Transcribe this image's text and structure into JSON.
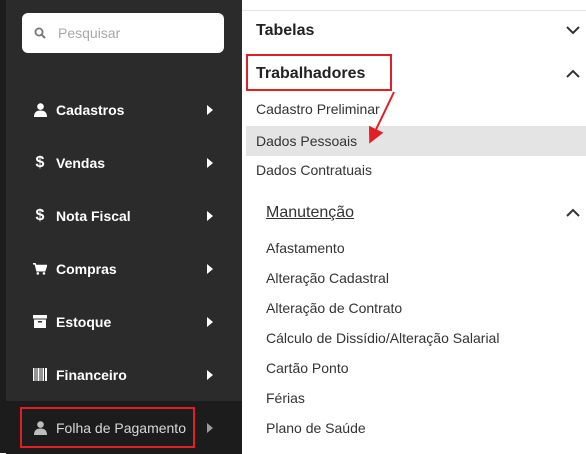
{
  "search": {
    "placeholder": "Pesquisar"
  },
  "sidebar": {
    "items": [
      {
        "label": "Cadastros",
        "icon": "user-icon"
      },
      {
        "label": "Vendas",
        "icon": "dollar-icon"
      },
      {
        "label": "Nota Fiscal",
        "icon": "dollar-icon"
      },
      {
        "label": "Compras",
        "icon": "cart-icon"
      },
      {
        "label": "Estoque",
        "icon": "box-icon"
      },
      {
        "label": "Financeiro",
        "icon": "barcode-icon"
      },
      {
        "label": "Folha de Pagamento",
        "icon": "user-icon",
        "active": true
      }
    ]
  },
  "panel": {
    "tabelas": "Tabelas",
    "trabalhadores": "Trabalhadores",
    "trab_items": [
      "Cadastro Preliminar",
      "Dados Pessoais",
      "Dados Contratuais"
    ],
    "selected_item": "Dados Pessoais",
    "manutencao": "Manutenção",
    "manut_items": [
      "Afastamento",
      "Alteração Cadastral",
      "Alteração de Contrato",
      "Cálculo de Dissídio/Alteração Salarial",
      "Cartão Ponto",
      "Férias",
      "Plano de Saúde"
    ]
  },
  "colors": {
    "sidebar_bg": "#2b2b2b",
    "highlight": "#e31e24",
    "selected_bg": "#e4e4e4"
  }
}
